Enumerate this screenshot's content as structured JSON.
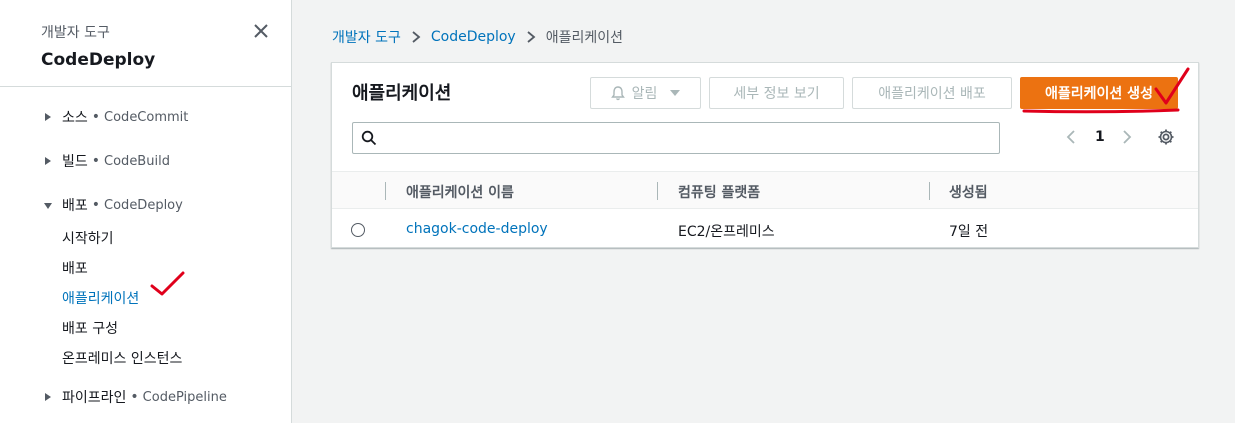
{
  "sidebar": {
    "subtitle": "개발자 도구",
    "title": "CodeDeploy",
    "sections": [
      {
        "label": "소스",
        "service": "CodeCommit",
        "expanded": false
      },
      {
        "label": "빌드",
        "service": "CodeBuild",
        "expanded": false
      },
      {
        "label": "배포",
        "service": "CodeDeploy",
        "expanded": true
      },
      {
        "label": "파이프라인",
        "service": "CodePipeline",
        "expanded": false
      }
    ],
    "deploy_items": [
      "시작하기",
      "배포",
      "애플리케이션",
      "배포 구성",
      "온프레미스 인스턴스"
    ],
    "active_item": "애플리케이션"
  },
  "breadcrumb": {
    "items": [
      "개발자 도구",
      "CodeDeploy"
    ],
    "current": "애플리케이션"
  },
  "panel": {
    "title": "애플리케이션",
    "buttons": {
      "notify": "알림",
      "details": "세부 정보 보기",
      "deploy": "애플리케이션 배포",
      "create": "애플리케이션 생성"
    },
    "search": {
      "value": "",
      "placeholder": ""
    },
    "page": "1"
  },
  "table": {
    "columns": [
      "애플리케이션 이름",
      "컴퓨팅 플랫폼",
      "생성됨"
    ],
    "rows": [
      {
        "name": "chagok-code-deploy",
        "platform": "EC2/온프레미스",
        "created": "7일 전"
      }
    ]
  },
  "colors": {
    "primary": "#ec7211",
    "link": "#0073bb",
    "annotation": "#e0001b"
  }
}
